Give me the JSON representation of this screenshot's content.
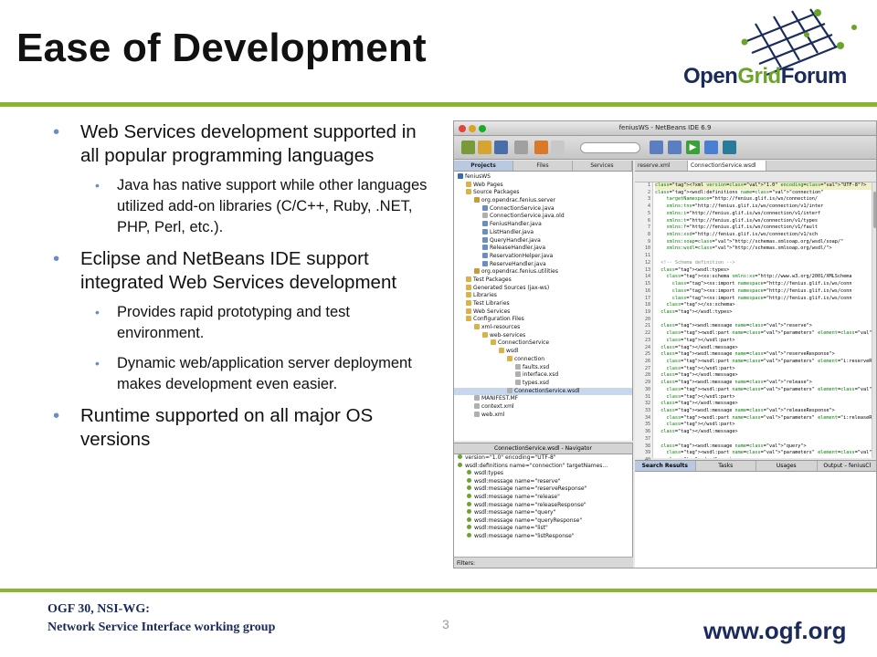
{
  "slide": {
    "title": "Ease of Development",
    "page_number": "3",
    "footer_line1": "OGF 30, NSI-WG:",
    "footer_line2": "Network Service Interface working group",
    "footer_url": "www.ogf.org"
  },
  "logo": {
    "part1": "Open",
    "part2": "Grid",
    "part3": "Forum"
  },
  "bullets": [
    {
      "text": "Web Services development supported in all popular programming languages",
      "sub": [
        "Java has native support while other languages utilized add-on libraries (C/C++, Ruby, .NET, PHP, Perl, etc.)."
      ]
    },
    {
      "text": "Eclipse and NetBeans IDE support integrated Web Services development",
      "sub": [
        "Provides rapid prototyping and test environment.",
        "Dynamic web/application server deployment makes development even easier."
      ]
    },
    {
      "text": "Runtime supported on all major OS versions",
      "sub": []
    }
  ],
  "ide": {
    "window_title": "feniusWS - NetBeans IDE 6.9",
    "left_tabs": [
      "Projects",
      "Files",
      "Services"
    ],
    "tree": [
      {
        "label": "feniusWS",
        "indent": 0,
        "kind": "proj"
      },
      {
        "label": "Web Pages",
        "indent": 1,
        "kind": "folder"
      },
      {
        "label": "Source Packages",
        "indent": 1,
        "kind": "folder"
      },
      {
        "label": "org.opendrac.fenius.server",
        "indent": 2,
        "kind": "pkg"
      },
      {
        "label": "ConnectionService.java",
        "indent": 3,
        "kind": "java"
      },
      {
        "label": "ConnectionService.java.old",
        "indent": 3,
        "kind": "file"
      },
      {
        "label": "FeniusHandler.java",
        "indent": 3,
        "kind": "java"
      },
      {
        "label": "ListHandler.java",
        "indent": 3,
        "kind": "java"
      },
      {
        "label": "QueryHandler.java",
        "indent": 3,
        "kind": "java"
      },
      {
        "label": "ReleaseHandler.java",
        "indent": 3,
        "kind": "java"
      },
      {
        "label": "ReservationHelper.java",
        "indent": 3,
        "kind": "java"
      },
      {
        "label": "ReserveHandler.java",
        "indent": 3,
        "kind": "java"
      },
      {
        "label": "org.opendrac.fenius.utilities",
        "indent": 2,
        "kind": "pkg"
      },
      {
        "label": "Test Packages",
        "indent": 1,
        "kind": "folder"
      },
      {
        "label": "Generated Sources (jax-ws)",
        "indent": 1,
        "kind": "folder"
      },
      {
        "label": "Libraries",
        "indent": 1,
        "kind": "folder"
      },
      {
        "label": "Test Libraries",
        "indent": 1,
        "kind": "folder"
      },
      {
        "label": "Web Services",
        "indent": 1,
        "kind": "folder"
      },
      {
        "label": "Configuration Files",
        "indent": 1,
        "kind": "folder"
      },
      {
        "label": "xml-resources",
        "indent": 2,
        "kind": "folder"
      },
      {
        "label": "web-services",
        "indent": 3,
        "kind": "folder"
      },
      {
        "label": "ConnectionService",
        "indent": 4,
        "kind": "folder"
      },
      {
        "label": "wsdl",
        "indent": 5,
        "kind": "folder"
      },
      {
        "label": "connection",
        "indent": 6,
        "kind": "folder"
      },
      {
        "label": "faults.xsd",
        "indent": 7,
        "kind": "file"
      },
      {
        "label": "interface.xsd",
        "indent": 7,
        "kind": "file"
      },
      {
        "label": "types.xsd",
        "indent": 7,
        "kind": "file"
      },
      {
        "label": "ConnectionService.wsdl",
        "indent": 6,
        "kind": "file",
        "selected": true
      },
      {
        "label": "MANIFEST.MF",
        "indent": 2,
        "kind": "file"
      },
      {
        "label": "context.xml",
        "indent": 2,
        "kind": "file"
      },
      {
        "label": "web.xml",
        "indent": 2,
        "kind": "file"
      }
    ],
    "navigator_title": "ConnectionService.wsdl - Navigator",
    "navigator": [
      "version=\"1.0\" encoding=\"UTF-8\"",
      "wsdl:definitions name=\"connection\" targetNames...",
      "wsdl:types",
      "wsdl:message name=\"reserve\"",
      "wsdl:message name=\"reserveResponse\"",
      "wsdl:message name=\"release\"",
      "wsdl:message name=\"releaseResponse\"",
      "wsdl:message name=\"query\"",
      "wsdl:message name=\"queryResponse\"",
      "wsdl:message name=\"list\"",
      "wsdl:message name=\"listResponse\""
    ],
    "filters_label": "Filters:",
    "editor_tabs": [
      "reserve.xml",
      "ConnectionService.wsdl"
    ],
    "code_lines": [
      "<?xml version=\"1.0\" encoding=\"UTF-8\"?>",
      "<wsdl:definitions name=\"connection\"",
      "    targetNamespace=\"http://fenius.glif.is/ws/connection/",
      "    xmlns:tns=\"http://fenius.glif.is/ws/connection/v1/inter",
      "    xmlns:i=\"http://fenius.glif.is/ws/connection/v1/interf",
      "    xmlns:t=\"http://fenius.glif.is/ws/connection/v1/types",
      "    xmlns:f=\"http://fenius.glif.is/ws/connection/v1/fault",
      "    xmlns:xsd=\"http://fenius.glif.is/ws/connection/v1/sch",
      "    xmlns:soap=\"http://schemas.xmlsoap.org/wsdl/soap/\"",
      "    xmlns:wsdl=\"http://schemas.xmlsoap.org/wsdl/\">",
      "",
      "  <!-- Schema definition -->",
      "  <wsdl:types>",
      "    <xs:schema xmlns:xs=\"http://www.w3.org/2001/XMLSchema",
      "      <xs:import namespace=\"http://fenius.glif.is/ws/conn",
      "      <xs:import namespace=\"http://fenius.glif.is/ws/conn",
      "      <xs:import namespace=\"http://fenius.glif.is/ws/conn",
      "    </xs:schema>",
      "  </wsdl:types>",
      "",
      "  <wsdl:message name=\"reserve\">",
      "    <wsdl:part name=\"parameters\" element=\"i:reserve\">",
      "    </wsdl:part>",
      "  </wsdl:message>",
      "  <wsdl:message name=\"reserveResponse\">",
      "    <wsdl:part name=\"parameters\" element=\"i:reserveRespon",
      "    </wsdl:part>",
      "  </wsdl:message>",
      "  <wsdl:message name=\"release\">",
      "    <wsdl:part name=\"parameters\" element=\"i:release\">",
      "    </wsdl:part>",
      "  </wsdl:message>",
      "  <wsdl:message name=\"releaseResponse\">",
      "    <wsdl:part name=\"parameters\" element=\"i:releaseRespons",
      "    </wsdl:part>",
      "  </wsdl:message>",
      "",
      "  <wsdl:message name=\"query\">",
      "    <wsdl:part name=\"parameters\" element=\"i:query\">",
      "    </wsdl:part>",
      "  </wsdl:message>",
      "  <wsdl:message name=\"queryResponse\">",
      "    <wsdl:part name=\"parameters\" element=\"i:queryResponse",
      "    </wsdl:part>"
    ],
    "output_tabs": [
      "Search Results",
      "Tasks",
      "Usages",
      "Output – feniusCl"
    ],
    "colors": {
      "accent": "#8ab532",
      "navy": "#1a2a5a",
      "bullet": "#6a8ec0"
    }
  }
}
